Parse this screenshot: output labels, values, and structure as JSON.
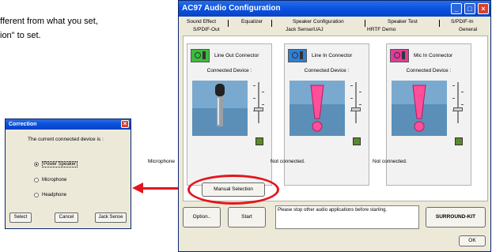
{
  "instructions": {
    "line1": "fferent from what you set,",
    "line2": "ion\" to set."
  },
  "correction_dialog": {
    "title": "Correction",
    "message": "The current connected device is :",
    "options": [
      {
        "label": "Power Speaker",
        "selected": true
      },
      {
        "label": "Microphone",
        "selected": false
      },
      {
        "label": "Headphone",
        "selected": false
      }
    ],
    "buttons": {
      "select": "Select",
      "cancel": "Cancel",
      "jack_sense": "Jack Sense"
    }
  },
  "window": {
    "title": "AC97 Audio Configuration",
    "tabs_row1": [
      "Sound Effect",
      "Equalizer",
      "Speaker Configuration",
      "Speaker Test",
      "S/PDIF-In"
    ],
    "tabs_row2": [
      "S/PDIF-Out",
      "Jack Sense/UAJ",
      "HRTF Demo",
      "General"
    ],
    "connectors": [
      {
        "title": "Line Out Connector",
        "device_label": "Connected Device :",
        "status": "Microphone",
        "icon": "line-out-icon",
        "color": "#3dbb3d"
      },
      {
        "title": "Line In Connector",
        "device_label": "Connected Device :",
        "status": "Not connected.",
        "icon": "line-in-icon",
        "color": "#2f7fd6"
      },
      {
        "title": "Mic In Connector",
        "device_label": "Connected Device :",
        "status": "Not connected.",
        "icon": "mic-in-icon",
        "color": "#e33a9c"
      }
    ],
    "manual_selection": "Manual Selection",
    "option_button": "Option..",
    "start_button": "Start",
    "message": "Please stop other audio applications before starting.",
    "surround_kit": "SURROUND-KIT",
    "ok_button": "OK"
  },
  "colors": {
    "arrow": "#e3161d",
    "titlebar": "#0a54e3",
    "exclamation": "#ff4f9a"
  }
}
